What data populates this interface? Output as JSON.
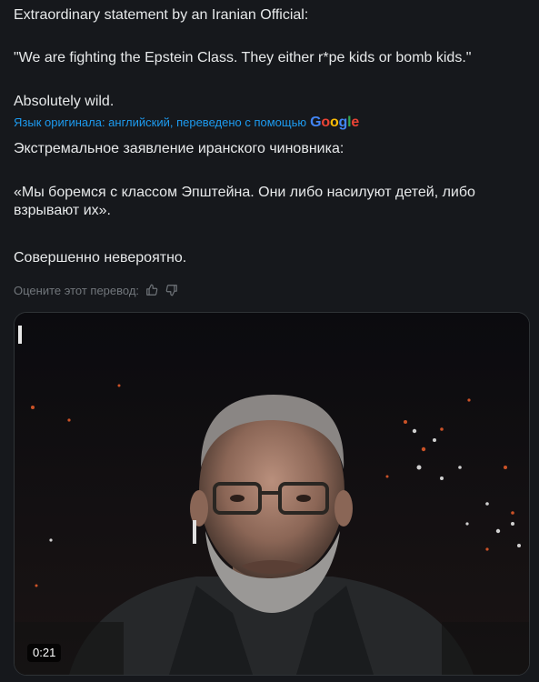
{
  "post": {
    "original_line1": "Extraordinary statement by an Iranian Official:",
    "original_line2": "\"We are fighting the Epstein Class. They either r*pe kids or bomb kids.\"",
    "original_line3": "Absolutely wild.",
    "translation_note": "Язык оригинала: английский, переведено с помощью",
    "google_logo": "Google",
    "translated_line1": "Экстремальное заявление иранского чиновника:",
    "translated_line2": "«Мы боремся с классом Эпштейна. Они либо насилуют детей, либо взрывают их».",
    "translated_line3": "Совершенно невероятно.",
    "rate_label": "Оцените этот перевод:"
  },
  "video": {
    "duration": "0:21"
  },
  "icons": {
    "thumbs_up": "thumbs-up-icon",
    "thumbs_down": "thumbs-down-icon"
  },
  "colors": {
    "background": "#16181c",
    "text": "#e7e9ea",
    "link": "#1d9bf0",
    "muted": "#71767b"
  }
}
